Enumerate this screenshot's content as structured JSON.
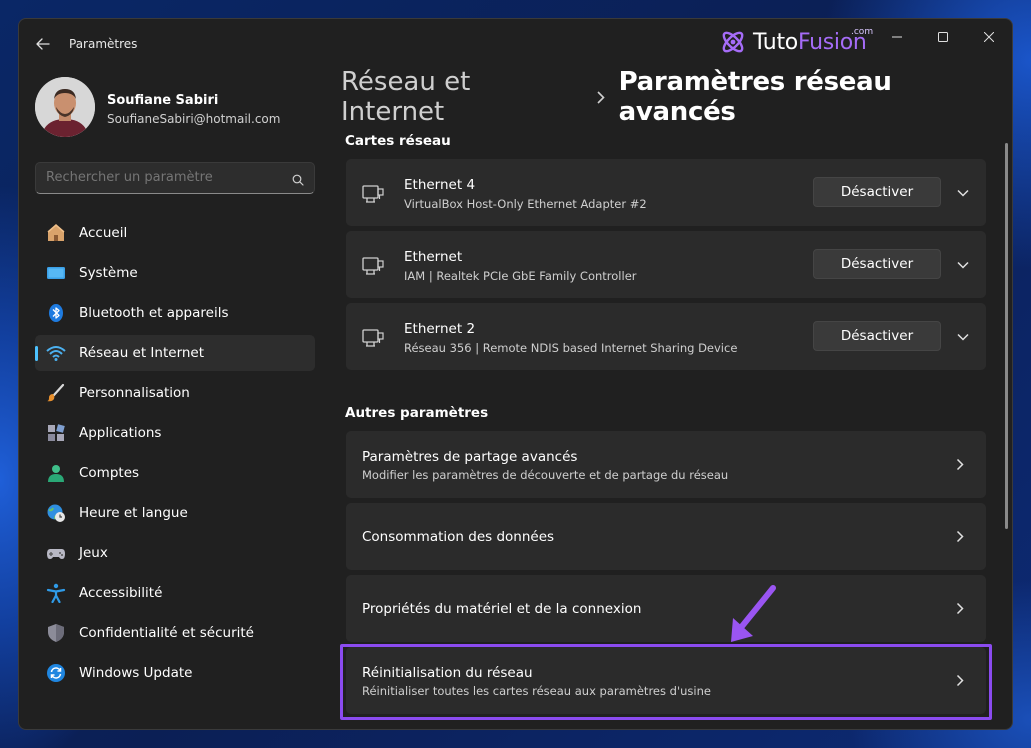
{
  "window": {
    "title": "Paramètres"
  },
  "logo": {
    "part1": "Tuto",
    "part2": "Fusion",
    "suffix": ".com"
  },
  "profile": {
    "name": "Soufiane Sabiri",
    "email": "SoufianeSabiri@hotmail.com"
  },
  "search": {
    "placeholder": "Rechercher un paramètre"
  },
  "sidebar": {
    "items": [
      {
        "label": "Accueil",
        "icon": "home-icon"
      },
      {
        "label": "Système",
        "icon": "monitor-icon"
      },
      {
        "label": "Bluetooth et appareils",
        "icon": "bluetooth-icon"
      },
      {
        "label": "Réseau et Internet",
        "icon": "wifi-icon",
        "active": true
      },
      {
        "label": "Personnalisation",
        "icon": "brush-icon"
      },
      {
        "label": "Applications",
        "icon": "apps-icon"
      },
      {
        "label": "Comptes",
        "icon": "account-icon"
      },
      {
        "label": "Heure et langue",
        "icon": "globe-clock-icon"
      },
      {
        "label": "Jeux",
        "icon": "gamepad-icon"
      },
      {
        "label": "Accessibilité",
        "icon": "accessibility-icon"
      },
      {
        "label": "Confidentialité et sécurité",
        "icon": "shield-icon"
      },
      {
        "label": "Windows Update",
        "icon": "update-icon"
      }
    ]
  },
  "breadcrumb": {
    "parent": "Réseau et Internet",
    "current": "Paramètres réseau avancés"
  },
  "adapters": {
    "title": "Cartes réseau",
    "items": [
      {
        "name": "Ethernet 4",
        "desc": "VirtualBox Host-Only Ethernet Adapter #2",
        "button": "Désactiver"
      },
      {
        "name": "Ethernet",
        "desc": "IAM | Realtek PCIe GbE Family Controller",
        "button": "Désactiver"
      },
      {
        "name": "Ethernet 2",
        "desc": "Réseau 356 | Remote NDIS based Internet Sharing Device",
        "button": "Désactiver"
      }
    ]
  },
  "other": {
    "title": "Autres paramètres",
    "items": [
      {
        "title": "Paramètres de partage avancés",
        "desc": "Modifier les paramètres de découverte et de partage du réseau"
      },
      {
        "title": "Consommation des données",
        "desc": ""
      },
      {
        "title": "Propriétés du matériel et de la connexion",
        "desc": ""
      },
      {
        "title": "Réinitialisation du réseau",
        "desc": "Réinitialiser toutes les cartes réseau aux paramètres d'usine"
      }
    ]
  },
  "colors": {
    "accent": "#4cc2ff",
    "highlight": "#8b4bf0",
    "background": "#202020",
    "card": "#2b2b2b"
  }
}
